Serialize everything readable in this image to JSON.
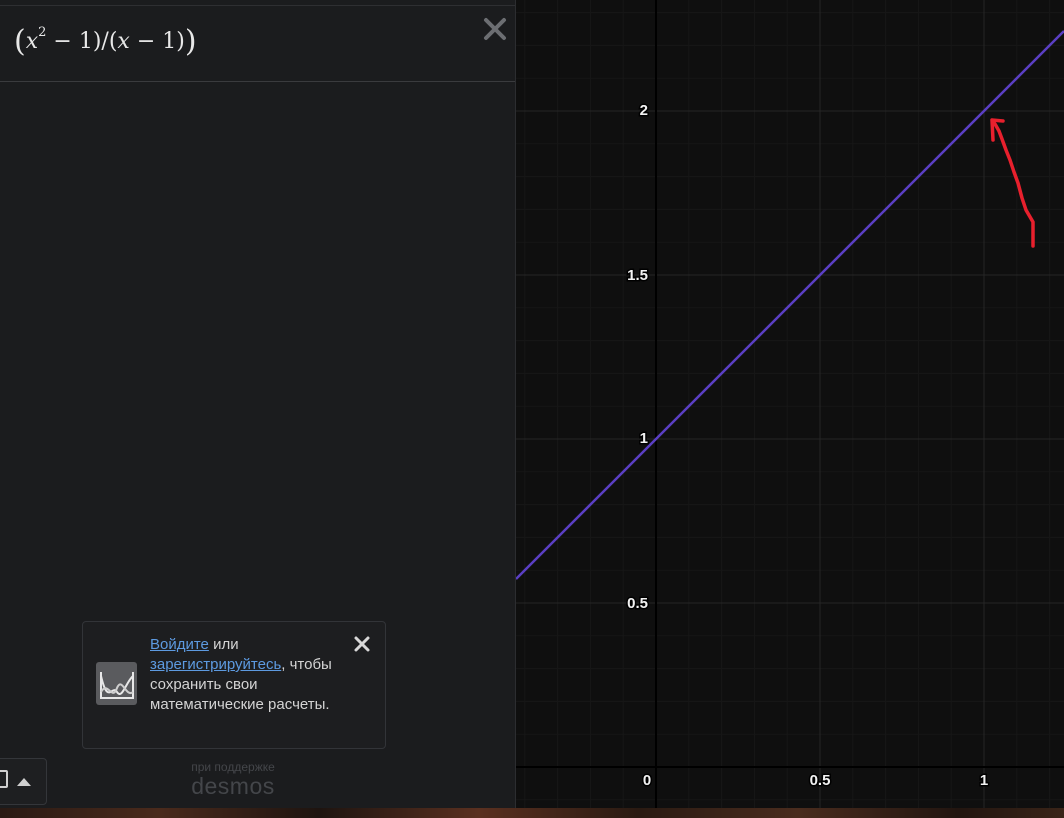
{
  "expression": {
    "numerator_base": "x",
    "exponent": "2",
    "minus_one": " − 1)/(",
    "denominator_var": "x",
    "denominator_tail": " − 1)"
  },
  "login_prompt": {
    "login_link": "Войдите",
    "or_text": " или ",
    "register_link": "зарегистрируйтесь",
    "rest_text": ", чтобы сохранить свои математические расчеты."
  },
  "branding": {
    "powered_by": "при поддержке",
    "logo": "desmos"
  },
  "graph": {
    "y_tick_labels": [
      "2",
      "1.5",
      "1",
      "0.5"
    ],
    "x_tick_labels": [
      "0",
      "0.5",
      "1"
    ],
    "curve_color": "#5b3fc4",
    "annotation_color": "#e8202d"
  },
  "colors": {
    "panel_bg": "#1b1c1e",
    "graph_bg": "#0f0f0f",
    "link": "#5d9ae0"
  }
}
